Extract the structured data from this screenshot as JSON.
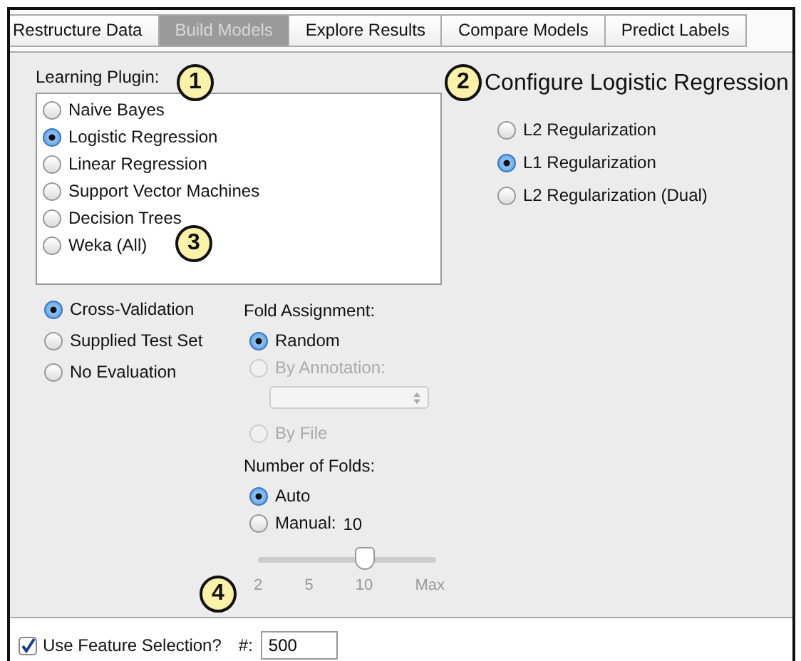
{
  "tabs": [
    {
      "label": "Restructure Data",
      "selected": false
    },
    {
      "label": "Build Models",
      "selected": true
    },
    {
      "label": "Explore Results",
      "selected": false
    },
    {
      "label": "Compare Models",
      "selected": false
    },
    {
      "label": "Predict Labels",
      "selected": false
    }
  ],
  "learning_plugin": {
    "label": "Learning Plugin:",
    "options": [
      {
        "label": "Naive Bayes",
        "selected": false
      },
      {
        "label": "Logistic Regression",
        "selected": true
      },
      {
        "label": "Linear Regression",
        "selected": false
      },
      {
        "label": "Support Vector Machines",
        "selected": false
      },
      {
        "label": "Decision Trees",
        "selected": false
      },
      {
        "label": "Weka (All)",
        "selected": false
      }
    ]
  },
  "configure": {
    "title": "Configure Logistic Regression",
    "options": [
      {
        "label": "L2 Regularization",
        "selected": false
      },
      {
        "label": "L1 Regularization",
        "selected": true
      },
      {
        "label": "L2 Regularization (Dual)",
        "selected": false
      }
    ]
  },
  "evaluation": {
    "options": [
      {
        "label": "Cross-Validation",
        "selected": true
      },
      {
        "label": "Supplied Test Set",
        "selected": false
      },
      {
        "label": "No Evaluation",
        "selected": false
      }
    ]
  },
  "fold_assignment": {
    "label": "Fold Assignment:",
    "options": [
      {
        "kind": "radio",
        "label": "Random",
        "selected": true,
        "disabled": false
      },
      {
        "kind": "radio",
        "label": "By Annotation:",
        "selected": false,
        "disabled": true
      },
      {
        "kind": "select",
        "disabled": true
      },
      {
        "kind": "radio",
        "label": "By File",
        "selected": false,
        "disabled": true
      }
    ]
  },
  "number_of_folds": {
    "label": "Number of Folds:",
    "options": [
      {
        "label": "Auto",
        "selected": true
      },
      {
        "label": "Manual:",
        "selected": false,
        "value": "10"
      }
    ],
    "slider": {
      "level": 0.6,
      "ticks": [
        "2",
        "5",
        "10",
        "Max"
      ]
    }
  },
  "feature_selection": {
    "checked": true,
    "label": "Use Feature Selection?",
    "count_label": "#:",
    "value": "500"
  },
  "callouts": [
    "1",
    "2",
    "3",
    "4"
  ]
}
